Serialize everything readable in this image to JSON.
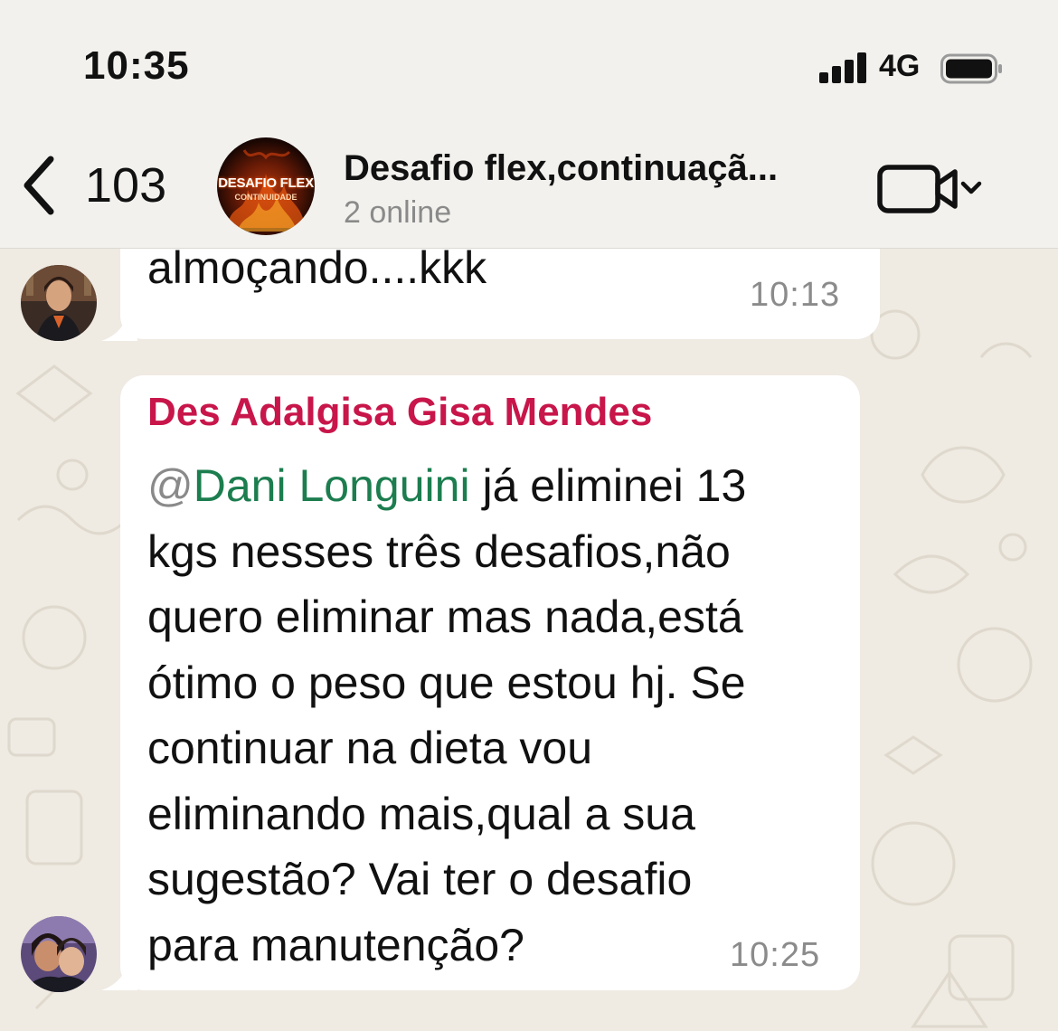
{
  "status_bar": {
    "time": "10:35",
    "network": "4G",
    "icons": [
      "signal-bars-icon",
      "battery-icon"
    ]
  },
  "header": {
    "back_count": "103",
    "title": "Desafio flex,continuaçã...",
    "subtitle": "2 online",
    "avatar_logo_line1": "DESAFIO FLEX",
    "avatar_logo_line2": "CONTINUIDADE",
    "icons": [
      "back-chevron-icon",
      "video-call-icon",
      "chevron-down-icon"
    ]
  },
  "messages": [
    {
      "text": "almoçando....kkk",
      "time": "10:13"
    },
    {
      "sender": "Des Adalgisa Gisa Mendes",
      "mention_at": "@",
      "mention_name": "Dani Longuini",
      "lines": [
        " já eliminei 13",
        "kgs nesses três desafios,não",
        "quero eliminar mas nada,está",
        "ótimo o peso que estou hj. Se",
        "continuar na dieta vou",
        "eliminando mais,qual a sua",
        "sugestão? Vai ter o desafio",
        "para manutenção?"
      ],
      "time": "10:25"
    }
  ],
  "colors": {
    "sender_name": "#c8164a",
    "mention": "#1c7d4f",
    "chat_background": "#efeae2",
    "bubble": "#ffffff",
    "header_background": "#f2f1ed"
  }
}
